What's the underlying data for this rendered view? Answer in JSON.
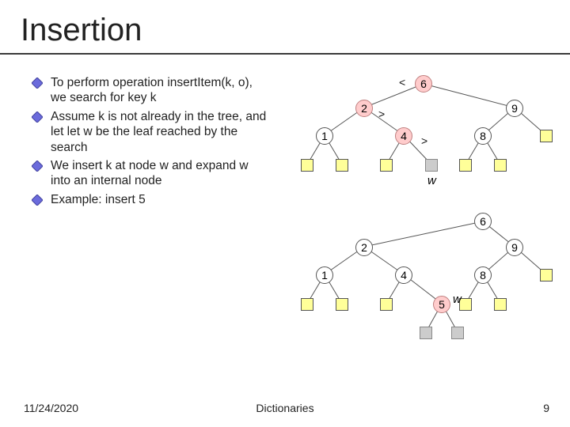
{
  "title": "Insertion",
  "bullets": [
    "To perform operation insertItem(k, o), we search for key k",
    "Assume k is not already in the tree, and let let w be the leaf reached by the search",
    "We insert k at node w and expand w into an internal node",
    "Example: insert 5"
  ],
  "footer": {
    "date": "11/24/2020",
    "center": "Dictionaries",
    "page": "9"
  },
  "tree1": {
    "nodes": {
      "n6": "6",
      "n2": "2",
      "n9": "9",
      "n1": "1",
      "n4": "4",
      "n8": "8"
    },
    "cmp": {
      "lt": "<",
      "gt1": ">",
      "gt2": ">"
    },
    "w": "w"
  },
  "tree2": {
    "nodes": {
      "n6": "6",
      "n2": "2",
      "n9": "9",
      "n1": "1",
      "n4": "4",
      "n8": "8",
      "n5": "5"
    },
    "w": "w"
  }
}
